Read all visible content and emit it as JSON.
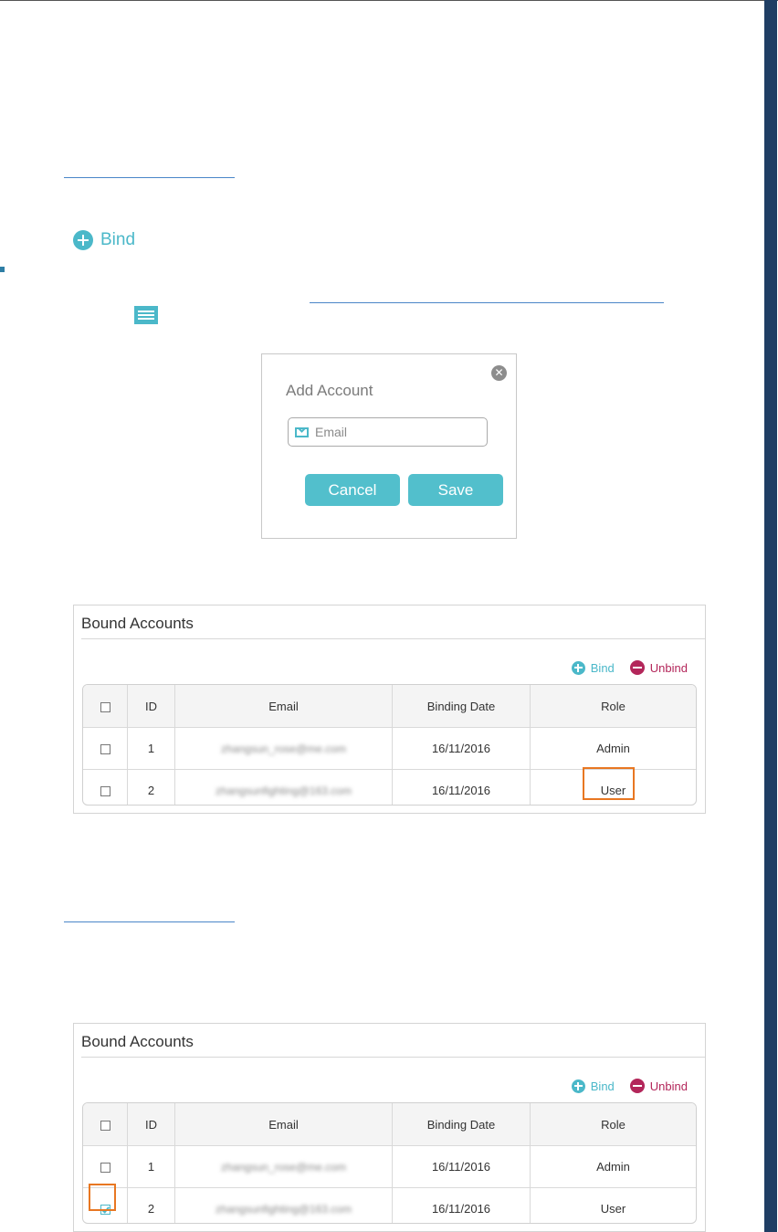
{
  "bind_link": {
    "label": "Bind"
  },
  "dialog": {
    "title": "Add Account",
    "email_placeholder": "Email",
    "cancel_label": "Cancel",
    "save_label": "Save"
  },
  "panels": [
    {
      "title": "Bound Accounts",
      "bind_label": "Bind",
      "unbind_label": "Unbind",
      "columns": [
        "ID",
        "Email",
        "Binding Date",
        "Role"
      ],
      "rows": [
        {
          "id": "1",
          "email": "zhangsun_rose@me.com",
          "date": "16/11/2016",
          "role": "Admin",
          "checked": false
        },
        {
          "id": "2",
          "email": "zhangsunfighting@163.com",
          "date": "16/11/2016",
          "role": "User",
          "checked": false
        }
      ],
      "highlight": "role-user"
    },
    {
      "title": "Bound Accounts",
      "bind_label": "Bind",
      "unbind_label": "Unbind",
      "columns": [
        "ID",
        "Email",
        "Binding Date",
        "Role"
      ],
      "rows": [
        {
          "id": "1",
          "email": "zhangsun_rose@me.com",
          "date": "16/11/2016",
          "role": "Admin",
          "checked": false
        },
        {
          "id": "2",
          "email": "zhangsunfighting@163.com",
          "date": "16/11/2016",
          "role": "User",
          "checked": true
        }
      ],
      "highlight": "row-2-checkbox"
    }
  ],
  "colors": {
    "accent": "#4bb8c9",
    "unbind": "#b3265a",
    "highlight": "#e87722"
  },
  "icons": [
    "plus-circle-icon",
    "menu-icon",
    "close-icon",
    "mail-icon",
    "minus-circle-icon",
    "checkbox-icon"
  ]
}
